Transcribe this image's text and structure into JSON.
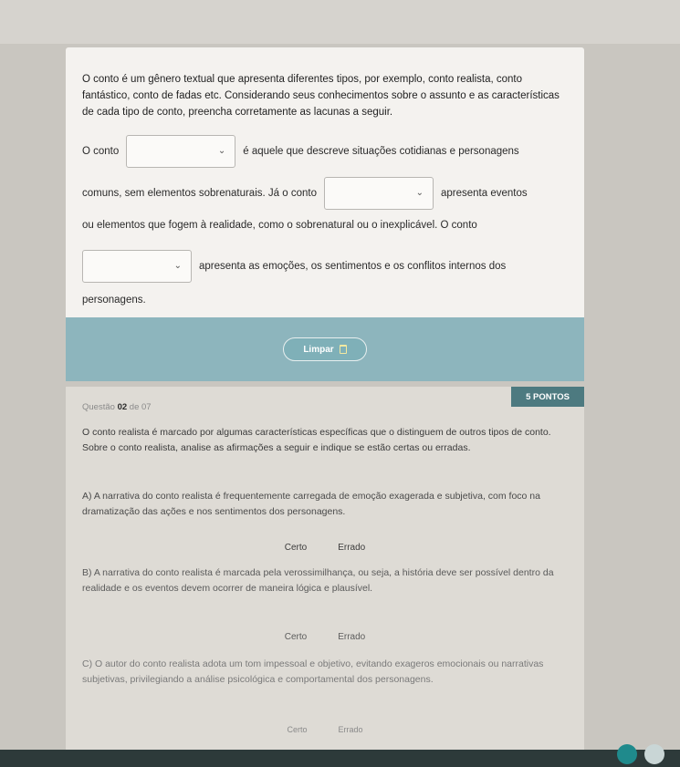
{
  "question1": {
    "intro": "O conto é um gênero textual que apresenta diferentes tipos, por exemplo, conto realista, conto fantástico, conto de fadas etc. Considerando seus conhecimentos sobre o assunto e as características de cada tipo de conto, preencha corretamente as lacunas a seguir.",
    "part1": "O conto",
    "part2": "é aquele que descreve situações cotidianas e personagens",
    "part3": "comuns, sem elementos sobrenaturais. Já o conto",
    "part4": "apresenta eventos",
    "part5": "ou elementos que fogem à realidade, como o sobrenatural ou o inexplicável. O conto",
    "part6": "apresenta as emoções, os sentimentos e os conflitos internos dos",
    "part7": "personagens.",
    "dropdown_chevron": "⌄",
    "clear_label": "Limpar"
  },
  "question2": {
    "label": "Questão",
    "number": "02",
    "of_total": "de 07",
    "points": "5 PONTOS",
    "text": "O conto realista é marcado por algumas características específicas que o distinguem de outros tipos de conto. Sobre o conto realista, analise as afirmações a seguir e indique se estão certas ou erradas.",
    "statements": [
      {
        "text": "A) A narrativa do conto realista é frequentemente carregada de emoção exagerada e subjetiva, com foco na dramatização das ações e nos sentimentos dos personagens.",
        "right": "Certo",
        "wrong": "Errado"
      },
      {
        "text": "B) A narrativa do conto realista é marcada pela verossimilhança, ou seja, a história deve ser possível dentro da realidade e os eventos devem ocorrer de maneira lógica e plausível.",
        "right": "Certo",
        "wrong": "Errado"
      },
      {
        "text": "C) O autor do conto realista adota um tom impessoal e objetivo, evitando exageros emocionais ou narrativas subjetivas, privilegiando a análise psicológica e comportamental dos personagens.",
        "right": "Certo",
        "wrong": "Errado"
      }
    ]
  }
}
